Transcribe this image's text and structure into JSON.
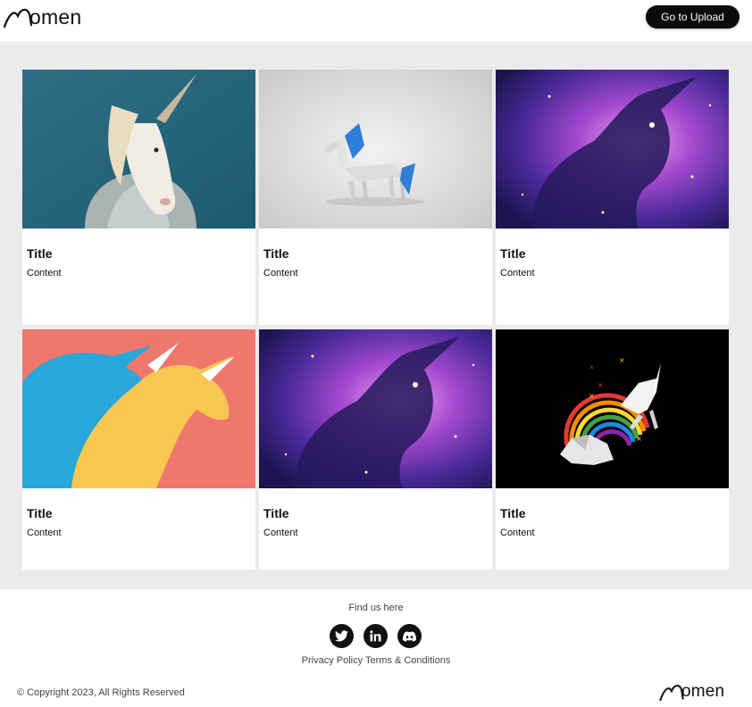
{
  "header": {
    "brand": "omen",
    "upload_label": "Go to Upload"
  },
  "cards": [
    {
      "title": "Title",
      "content": "Content",
      "image": "unicorn-in-hoodie"
    },
    {
      "title": "Title",
      "content": "Content",
      "image": "origami-unicorn"
    },
    {
      "title": "Title",
      "content": "Content",
      "image": "galaxy-unicorn"
    },
    {
      "title": "Title",
      "content": "Content",
      "image": "blue-yellow-unicorns"
    },
    {
      "title": "Title",
      "content": "Content",
      "image": "galaxy-unicorn"
    },
    {
      "title": "Title",
      "content": "Content",
      "image": "rainbow-unicorn-on-cloud"
    }
  ],
  "footer": {
    "find_us": "Find us here",
    "socials": [
      "twitter-icon",
      "linkedin-icon",
      "discord-icon"
    ],
    "privacy": "Privacy Policy",
    "terms": "Terms & Conditions",
    "copyright": "© Copyright 2023, All Rights Reserved",
    "brand": "omen"
  },
  "colors": {
    "button_bg": "#0b0b0b",
    "page_bg": "#ebebeb",
    "card_bg": "#ffffff"
  }
}
